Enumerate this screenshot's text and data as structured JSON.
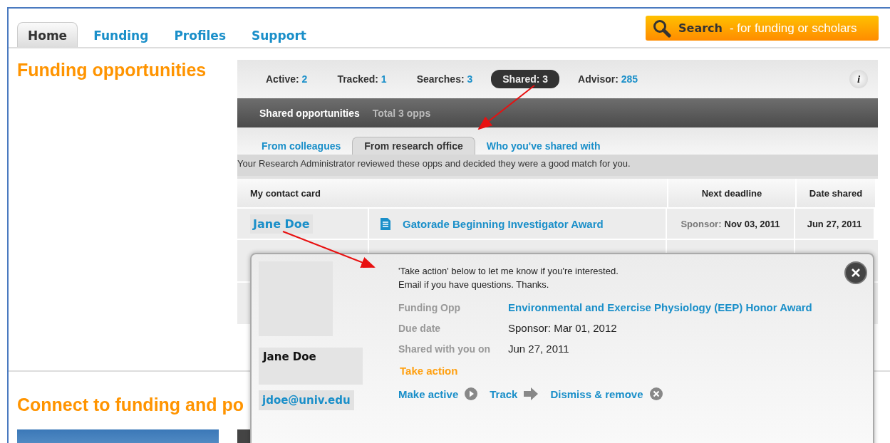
{
  "nav": {
    "tabs": [
      {
        "label": "Home",
        "selected": true
      },
      {
        "label": "Funding",
        "selected": false
      },
      {
        "label": "Profiles",
        "selected": false
      },
      {
        "label": "Support",
        "selected": false
      }
    ]
  },
  "search_button": {
    "label": "Search",
    "hint": "- for funding or scholars"
  },
  "page_title": "Funding opportunities",
  "stats": [
    {
      "label": "Active:",
      "value": "2",
      "selected": false
    },
    {
      "label": "Tracked:",
      "value": "1",
      "selected": false
    },
    {
      "label": "Searches:",
      "value": "3",
      "selected": false
    },
    {
      "label": "Shared:",
      "value": "3",
      "selected": true
    },
    {
      "label": "Advisor:",
      "value": "285",
      "selected": false
    }
  ],
  "info_button": "i",
  "shared_header": {
    "title": "Shared opportunities",
    "total": "Total 3 opps"
  },
  "subtabs": [
    {
      "label": "From colleagues",
      "selected": false
    },
    {
      "label": "From research office",
      "selected": true
    },
    {
      "label": "Who you've shared with",
      "selected": false
    }
  ],
  "message": "Your Research Administrator reviewed these opps and decided they were a good match for you.",
  "table": {
    "columns": [
      "My contact card",
      "Next deadline",
      "Date shared"
    ],
    "rows": [
      {
        "contact": "Jane Doe",
        "title": "Gatorade Beginning Investigator Award",
        "deadline_label": "Sponsor:",
        "deadline": "Nov 03, 2011",
        "date_shared": "Jun 27, 2011"
      }
    ]
  },
  "popup": {
    "name": "Jane Doe",
    "email": "jdoe@univ.edu",
    "note": [
      "'Take action' below to let me know if you're interested.",
      "Email if you have questions. Thanks."
    ],
    "fields": [
      {
        "label": "Funding Opp",
        "value": "Environmental and Exercise Physiology (EEP) Honor Award",
        "kind": "link"
      },
      {
        "label": "Due date",
        "value": "Sponsor: Mar 01, 2012",
        "kind": "text"
      },
      {
        "label": "Shared with you on",
        "value": "Jun 27, 2011",
        "kind": "text"
      }
    ],
    "take_action": "Take action",
    "actions": [
      {
        "label": "Make active",
        "kind": "play"
      },
      {
        "label": "Track",
        "kind": "arrow"
      },
      {
        "label": "Dismiss & remove",
        "kind": "remove"
      }
    ]
  },
  "section_title": "Connect to funding and po"
}
